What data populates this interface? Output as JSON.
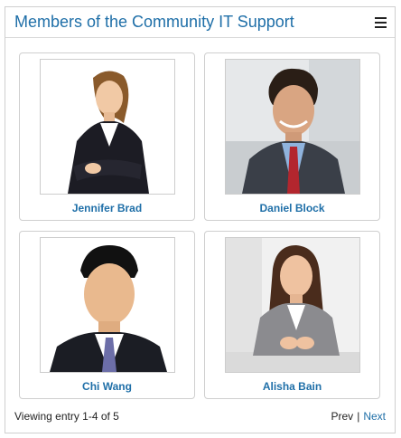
{
  "panel": {
    "title": "Members of the Community IT Support",
    "menu_icon": "hamburger-menu-icon"
  },
  "members": [
    {
      "name": "Jennifer Brad"
    },
    {
      "name": "Daniel Block"
    },
    {
      "name": "Chi Wang"
    },
    {
      "name": "Alisha Bain"
    }
  ],
  "footer": {
    "status": "Viewing entry 1-4 of 5",
    "prev_label": "Prev",
    "separator": "|",
    "next_label": "Next"
  },
  "colors": {
    "accent": "#1f6fa8",
    "border": "#cfcfcf"
  }
}
